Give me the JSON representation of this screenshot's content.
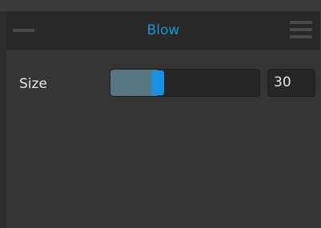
{
  "panel": {
    "title": "Blow",
    "minimize_icon": "minus-icon",
    "menu_icon": "hamburger-menu-icon",
    "accent_color": "#1b95d8"
  },
  "controls": {
    "size": {
      "label": "Size",
      "value": "30",
      "slider_fraction": 0.3
    }
  }
}
